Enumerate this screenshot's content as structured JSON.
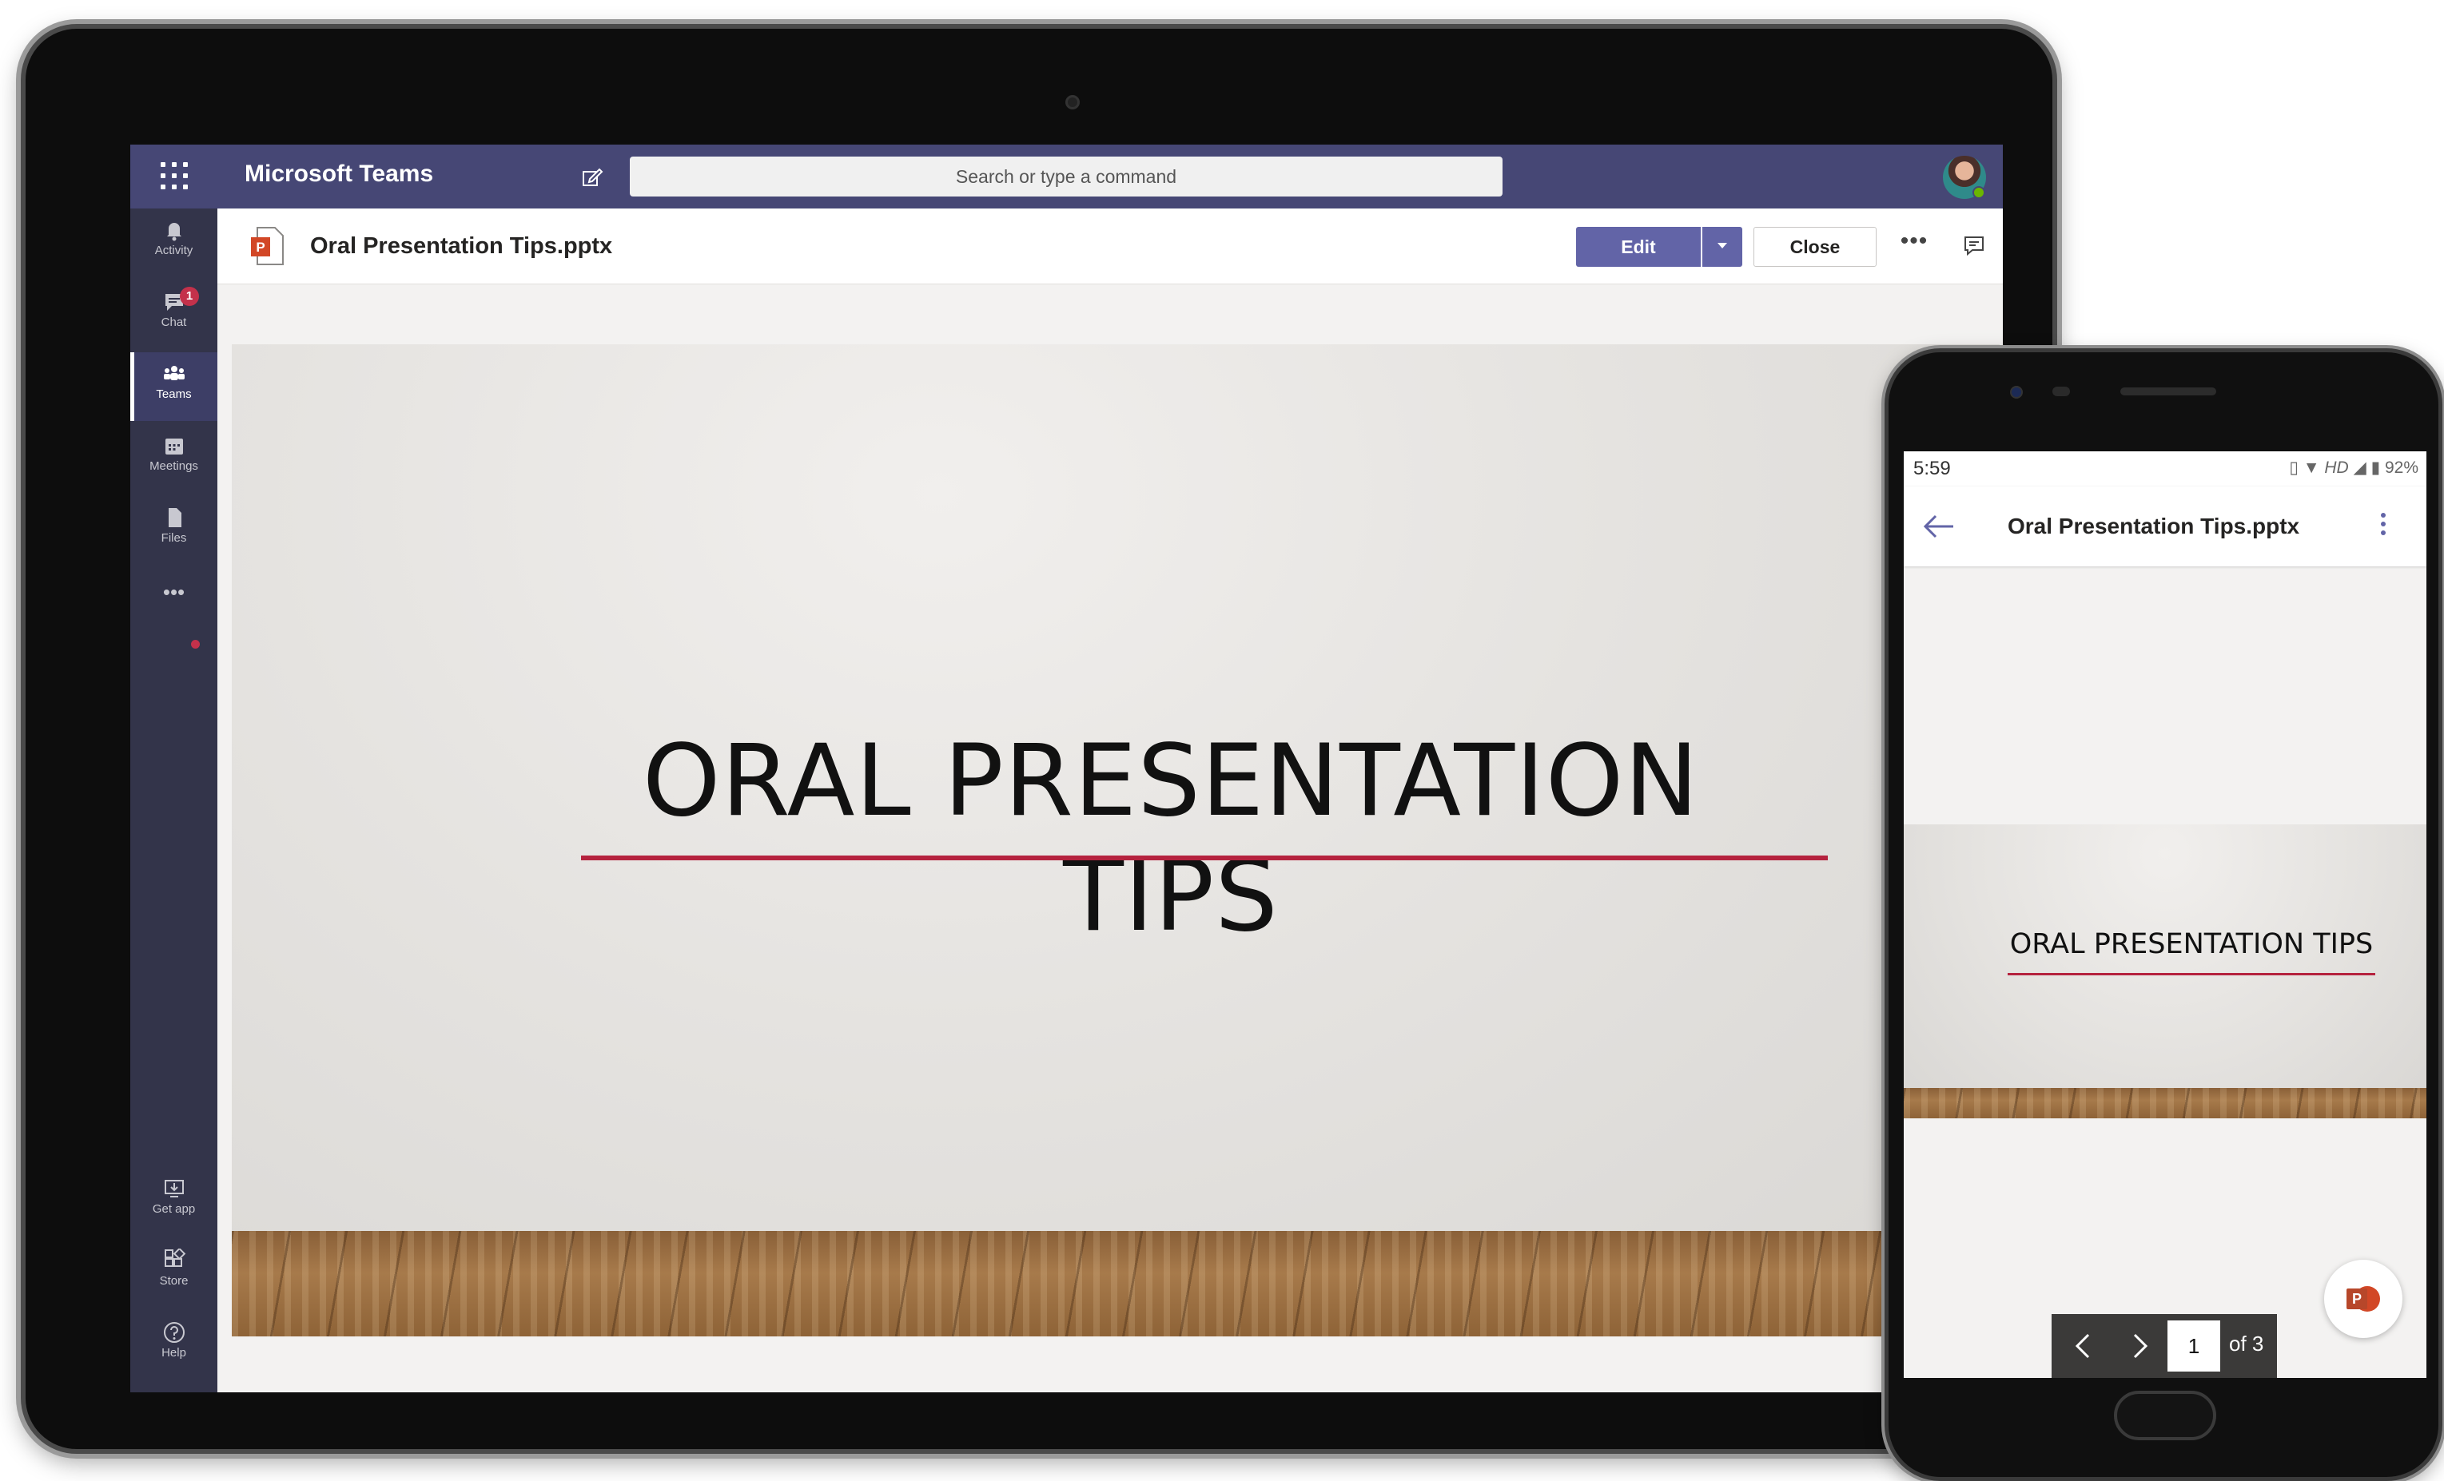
{
  "teams": {
    "app_name": "Microsoft Teams",
    "search_placeholder": "Search or type a command",
    "rail": [
      {
        "label": "Activity"
      },
      {
        "label": "Chat",
        "badge": "1"
      },
      {
        "label": "Teams"
      },
      {
        "label": "Meetings"
      },
      {
        "label": "Files"
      }
    ],
    "rail_bottom": [
      {
        "label": "Get app"
      },
      {
        "label": "Store"
      },
      {
        "label": "Help"
      }
    ],
    "more_label": "•••"
  },
  "file": {
    "title": "Oral Presentation Tips.pptx",
    "edit_label": "Edit",
    "close_label": "Close",
    "more_label": "•••"
  },
  "slide": {
    "title": "ORAL PRESENTATION TIPS"
  },
  "phone": {
    "time": "5:59",
    "status_hd": "HD",
    "battery": "92%",
    "title": "Oral Presentation Tips.pptx",
    "slide_title": "ORAL PRESENTATION TIPS",
    "page_current": "1",
    "page_of": "of 3"
  },
  "colors": {
    "teams_purple": "#464775",
    "rail": "#33344a",
    "edit_button": "#6264a7",
    "slide_accent": "#b5223e",
    "badge_red": "#c4314b"
  }
}
